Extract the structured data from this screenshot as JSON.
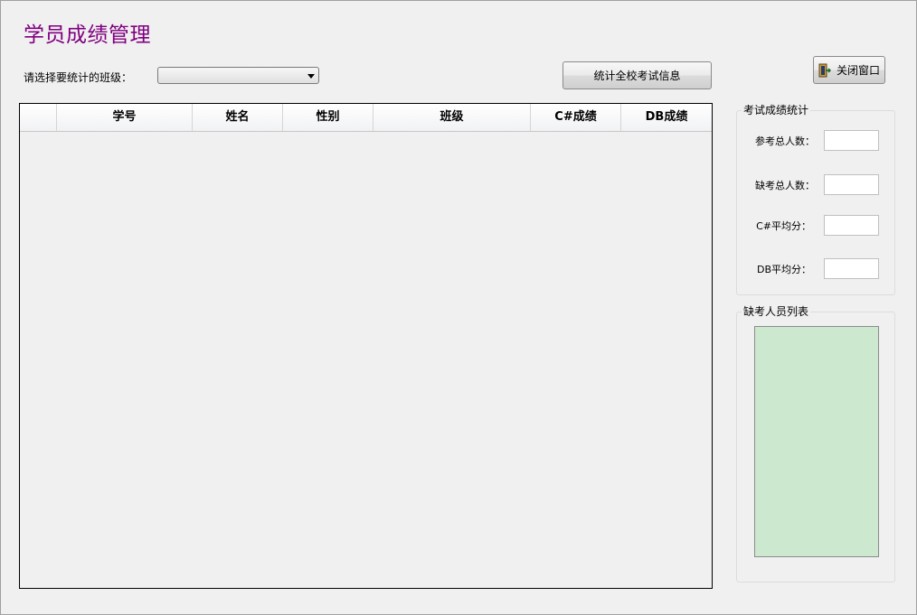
{
  "title": "学员成绩管理",
  "class_select": {
    "label": "请选择要统计的班级：",
    "value": ""
  },
  "buttons": {
    "stats_all": "统计全校考试信息",
    "close": "关闭窗口"
  },
  "table": {
    "columns": [
      "",
      "学号",
      "姓名",
      "性别",
      "班级",
      "C#成绩",
      "DB成绩"
    ],
    "rows": []
  },
  "stats_group": {
    "title": "考试成绩统计",
    "fields": [
      {
        "label": "参考总人数：",
        "value": ""
      },
      {
        "label": "缺考总人数：",
        "value": ""
      },
      {
        "label": "C#平均分：",
        "value": ""
      },
      {
        "label": "DB平均分：",
        "value": ""
      }
    ]
  },
  "absent_group": {
    "title": "缺考人员列表",
    "items": []
  },
  "colors": {
    "title": "#800080",
    "list_background": "#cce8cf",
    "window_background": "#f0f0f0"
  },
  "icons": {
    "close_button": "door-exit-icon",
    "select_arrow": "chevron-down-icon"
  }
}
